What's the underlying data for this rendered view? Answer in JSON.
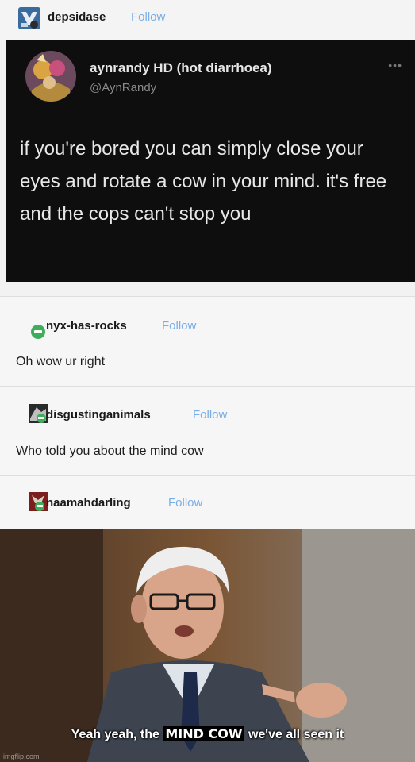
{
  "post": {
    "author": "depsidase",
    "follow_label": "Follow"
  },
  "tweet": {
    "display_name": "aynrandy HD (hot diarrhoea)",
    "handle": "@AynRandy",
    "more_label": "•••",
    "text": "if you're bored you can simply close your eyes and rotate a cow in your mind. it's free and the cops can't stop you"
  },
  "reblogs": [
    {
      "username": "nyx-has-rocks",
      "follow_label": "Follow",
      "comment": "Oh wow ur right"
    },
    {
      "username": "disgustinganimals",
      "follow_label": "Follow",
      "comment": "Who told you about the mind cow"
    },
    {
      "username": "naamahdarling",
      "follow_label": "Follow"
    }
  ],
  "meme": {
    "caption_pre": "Yeah yeah, the",
    "caption_highlight": "MIND COW",
    "caption_post": "we've all seen it",
    "watermark": "imgflip.com"
  },
  "colors": {
    "follow": "#7aaee6",
    "tweet_bg": "#0e0e0e",
    "page_bg": "#f2f2f2"
  }
}
